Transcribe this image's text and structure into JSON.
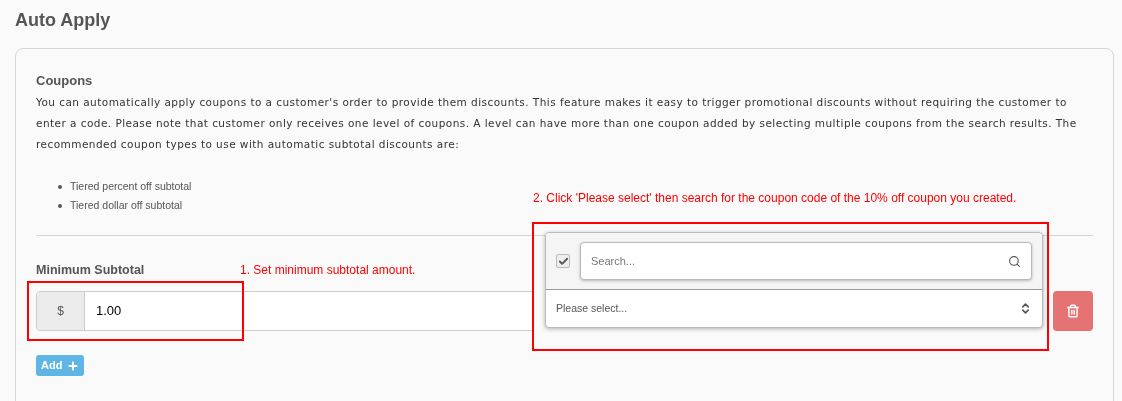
{
  "page_title": "Auto Apply",
  "coupons": {
    "heading": "Coupons",
    "description": "You can automatically apply coupons to a customer's order to provide them discounts. This feature makes it easy to trigger promotional discounts without requiring the customer to enter a code. Please note that customer only receives one level of coupons. A level can have more than one coupon added by selecting multiple coupons from the search results. The recommended coupon types to use with automatic subtotal discounts are:",
    "recommended_types": [
      "Tiered percent off subtotal",
      "Tiered dollar off subtotal"
    ]
  },
  "minimum_subtotal": {
    "label": "Minimum Subtotal",
    "currency": "$",
    "value": "1.00"
  },
  "coupon_dropdown": {
    "checked": true,
    "search_placeholder": "Search...",
    "select_placeholder": "Please select..."
  },
  "add_button": "Add",
  "annotations": [
    {
      "text": "2. Click 'Please select' then search for the coupon code of the 10% off coupon you created."
    },
    {
      "text": "1. Set minimum subtotal amount."
    }
  ]
}
